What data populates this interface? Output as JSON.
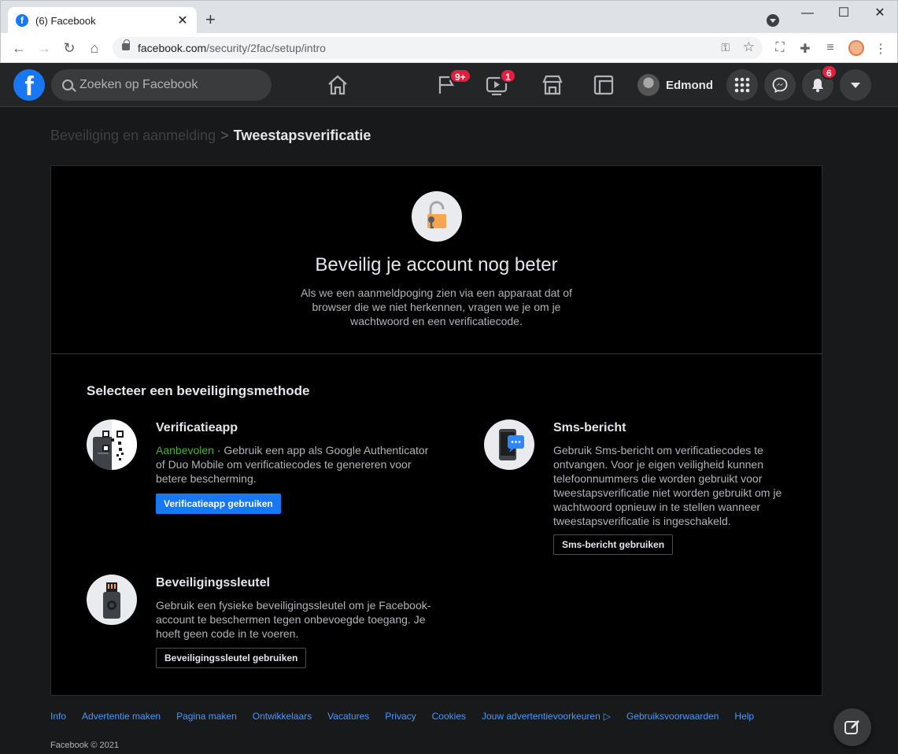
{
  "browser": {
    "tab_title": "(6) Facebook",
    "url_domain": "facebook.com",
    "url_path": "/security/2fac/setup/intro"
  },
  "fb_nav": {
    "search_placeholder": "Zoeken op Facebook",
    "pages_badge": "9+",
    "watch_badge": "1",
    "user_name": "Edmond",
    "notifications_badge": "6"
  },
  "breadcrumb": {
    "parent": "Beveiliging en aanmelding",
    "separator": ">",
    "current": "Tweestapsverificatie"
  },
  "hero": {
    "title": "Beveilig je account nog beter",
    "description": "Als we een aanmeldpoging zien via een apparaat dat of browser die we niet herkennen, vragen we je om je wachtwoord en een verificatiecode."
  },
  "select_title": "Selecteer een beveiligingsmethode",
  "methods": {
    "app": {
      "title": "Verificatieapp",
      "recommended": "Aanbevolen",
      "description": " · Gebruik een app als Google Authenticator of Duo Mobile om verificatiecodes te genereren voor betere bescherming.",
      "button": "Verificatieapp gebruiken"
    },
    "sms": {
      "title": "Sms-bericht",
      "description": "Gebruik Sms-bericht om verificatiecodes te ontvangen. Voor je eigen veiligheid kunnen telefoonnummers die worden gebruikt voor tweestapsverificatie niet worden gebruikt om je wachtwoord opnieuw in te stellen wanneer tweestapsverificatie is ingeschakeld.",
      "button": "Sms-bericht gebruiken"
    },
    "key": {
      "title": "Beveiligingssleutel",
      "description": "Gebruik een fysieke beveiligingssleutel om je Facebook-account te beschermen tegen onbevoegde toegang. Je hoeft geen code in te voeren.",
      "button": "Beveiligingssleutel gebruiken"
    }
  },
  "footer": {
    "links": [
      "Info",
      "Advertentie maken",
      "Pagina maken",
      "Ontwikkelaars",
      "Vacatures",
      "Privacy",
      "Cookies",
      "Jouw advertentievoorkeuren",
      "Gebruiksvoorwaarden",
      "Help"
    ],
    "copyright": "Facebook © 2021"
  },
  "colors": {
    "fb_blue": "#1877f2",
    "badge_red": "#e41e3f",
    "recommended_green": "#42b72a",
    "link_blue": "#4599ff"
  }
}
